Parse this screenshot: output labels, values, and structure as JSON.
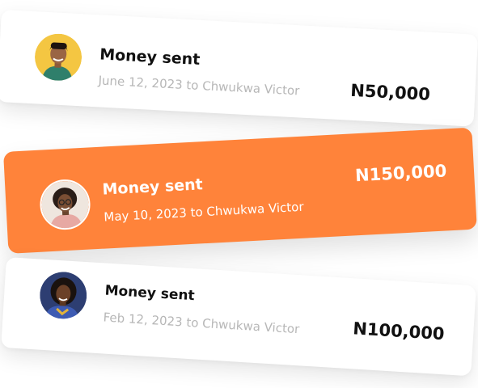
{
  "transactions": [
    {
      "title": "Money sent",
      "details": "June 12, 2023 to Chwukwa Victor",
      "amount": "N50,000",
      "avatar_bg": "#F4C642",
      "highlighted": false
    },
    {
      "title": "Money sent",
      "details": "May 10, 2023 to Chwukwa Victor",
      "amount": "N150,000",
      "avatar_bg": "#EFE6DE",
      "highlighted": true
    },
    {
      "title": "Money sent",
      "details": "Feb 12, 2023 to Chwukwa Victor",
      "amount": "N100,000",
      "avatar_bg": "#3A4F8F",
      "highlighted": false
    }
  ],
  "colors": {
    "accent": "#FF833A",
    "card": "#FFFFFF",
    "text_dark": "#111111",
    "text_muted": "#B7B7B7"
  }
}
